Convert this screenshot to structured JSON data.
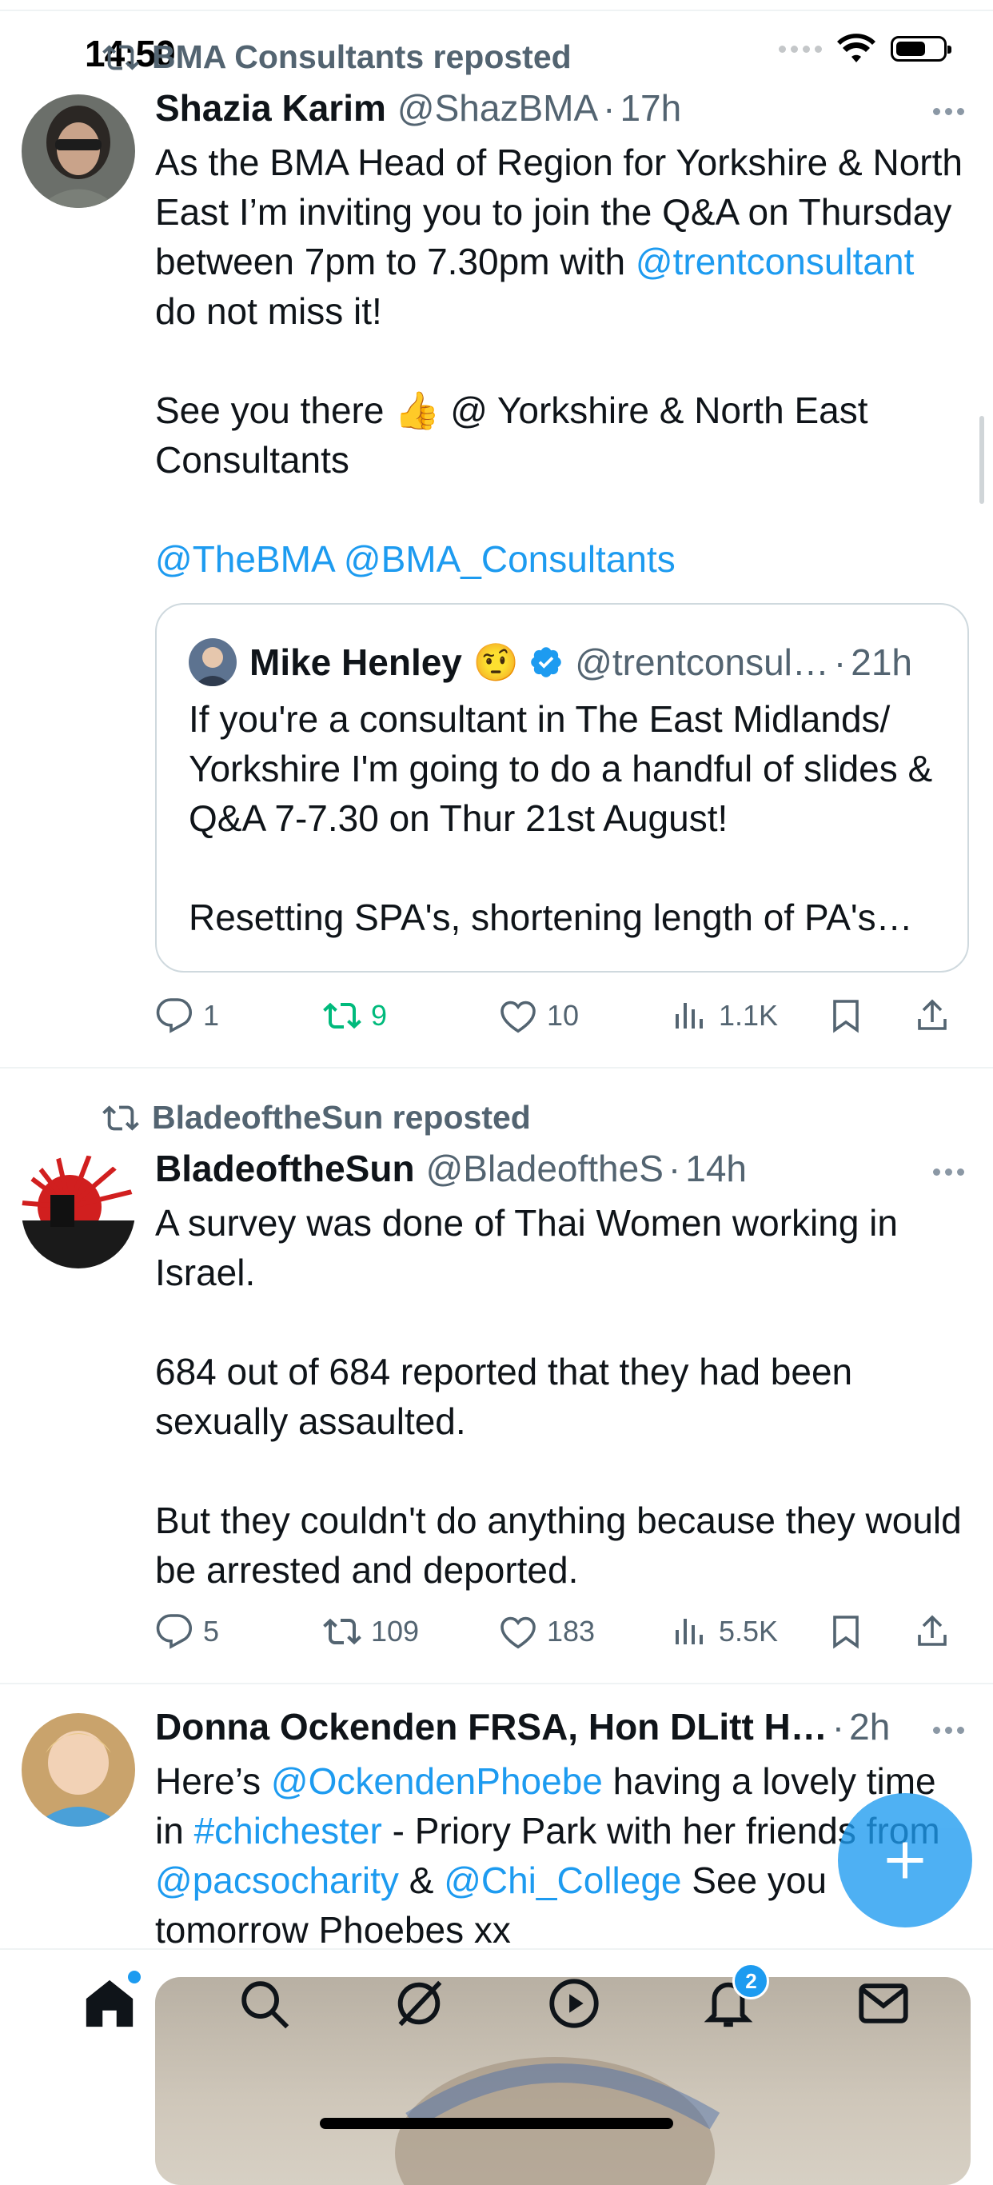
{
  "status_bar": {
    "time": "14:50"
  },
  "tweets": [
    {
      "repost_label": "BMA Consultants reposted",
      "name": "Shazia Karim",
      "handle": "@ShazBMA",
      "time": "17h",
      "body": {
        "line1": "As the BMA Head of Region for Yorkshire & North East I’m inviting you to join the Q&A on Thursday between 7pm to 7.30pm with ",
        "mention": "@trentconsultant",
        "line1_end": " do not miss it!",
        "para2": "See you there 👍 @ Yorkshire & North East Consultants",
        "mention2": "@TheBMA",
        "mention3": "@BMA_Consultants"
      },
      "quote": {
        "name": "Mike Henley",
        "emoji": "🤨",
        "handle": "@trentconsul…",
        "time": "21h",
        "para1": "If you're a consultant in The East Midlands/ Yorkshire I'm going to do a handful of slides & Q&A 7-7.30 on Thur 21st August!",
        "para2": "Resetting SPA's, shortening length of PA's…"
      },
      "actions": {
        "replies": "1",
        "reposts": "9",
        "likes": "10",
        "views": "1.1K"
      }
    },
    {
      "repost_label": "BladeoftheSun reposted",
      "name": "BladeoftheSun",
      "handle": "@BladeoftheS",
      "time": "14h",
      "body": {
        "para1": "A survey was done of Thai Women working in Israel.",
        "para2": "684 out of 684 reported that they had been sexually assaulted.",
        "para3": "But they couldn't do anything because they would be arrested and deported."
      },
      "actions": {
        "replies": "5",
        "reposts": "109",
        "likes": "183",
        "views": "5.5K"
      }
    },
    {
      "name": "Donna Ockenden FRSA, Hon DLitt H…",
      "time": "2h",
      "body": {
        "t1": "Here’s ",
        "m1": "@OckendenPhoebe",
        "t2": " having a lovely time in ",
        "m2": "#chichester",
        "t3": " - Priory Park with her friends from ",
        "m3": "@pacsocharity",
        "t4": " & ",
        "m4": "@Chi_College",
        "t5": " See you tomorrow Phoebes xx"
      }
    }
  ],
  "nav": {
    "notifications_badge": "2"
  },
  "colors": {
    "accent": "#1d9bf0",
    "retweet_green": "#00ba7c",
    "secondary_text": "#536471"
  }
}
